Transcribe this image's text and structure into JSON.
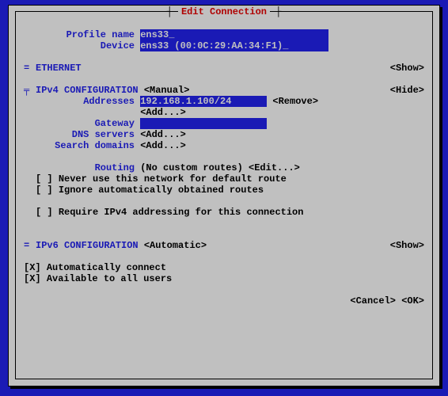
{
  "title": "Edit Connection",
  "labels": {
    "profile_name": "Profile name",
    "device": "Device",
    "addresses": "Addresses",
    "gateway": "Gateway",
    "dns_servers": "DNS servers",
    "search_domains": "Search domains",
    "routing": "Routing"
  },
  "values": {
    "profile_name": "ens33",
    "device": "ens33 (00:0C:29:AA:34:F1)",
    "address0": "192.168.1.100/24",
    "gateway": ""
  },
  "sections": {
    "ethernet": "ETHERNET",
    "ipv4": "IPv4 CONFIGURATION",
    "ipv6": "IPv6 CONFIGURATION"
  },
  "modes": {
    "ipv4": "<Manual>",
    "ipv6": "<Automatic>"
  },
  "buttons": {
    "show": "<Show>",
    "hide": "<Hide>",
    "remove": "<Remove>",
    "add": "<Add...>",
    "edit": "<Edit...>",
    "cancel": "<Cancel>",
    "ok": "<OK>"
  },
  "texts": {
    "routing_status": "(No custom routes)",
    "chk_never_default": "Never use this network for default route",
    "chk_ignore_routes": "Ignore automatically obtained routes",
    "chk_require_ipv4": "Require IPv4 addressing for this connection",
    "chk_autoconnect": "Automatically connect",
    "chk_all_users": "Available to all users"
  },
  "marks": {
    "header": "═",
    "section_toggle": "=",
    "section_open": "╤",
    "checked": "[X]",
    "unchecked": "[ ]",
    "underscore": "_"
  }
}
